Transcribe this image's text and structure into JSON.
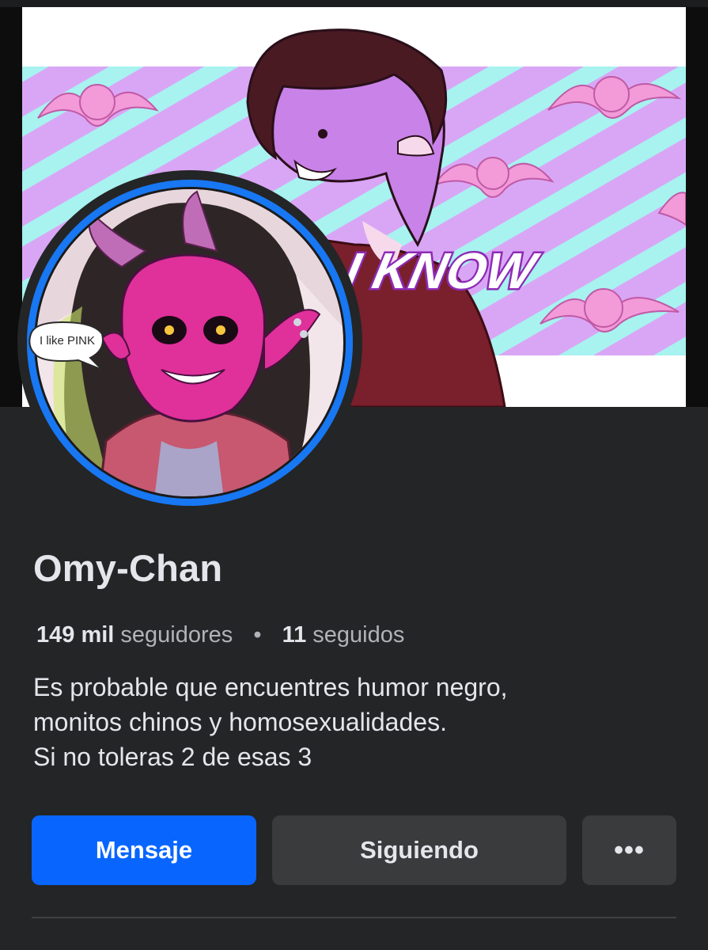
{
  "cover": {
    "image": "cover-photo",
    "caption_text": "I KNOW",
    "colors": {
      "stripe_lilac": "#d9a6f5",
      "stripe_cyan": "#a8f2f0",
      "bat_pink": "#f39ad8"
    }
  },
  "avatar": {
    "image": "profile-picture",
    "speech_bubble_text": "I like PINK",
    "ring_color": "#1877f2"
  },
  "profile": {
    "name": "Omy-Chan",
    "followers_count": "149 mil",
    "followers_label": "seguidores",
    "separator": "•",
    "following_count": "11",
    "following_label": "seguidos",
    "bio_lines": [
      "Es probable que encuentres humor negro,",
      "monitos chinos y homosexualidades.",
      "Si no toleras 2 de esas 3"
    ]
  },
  "actions": {
    "message_label": "Mensaje",
    "following_label": "Siguiendo",
    "more_label": "•••"
  },
  "colors": {
    "background": "#242526",
    "primary_button": "#0866ff",
    "secondary_button": "#3a3b3c",
    "text_primary": "#e4e6eb",
    "text_secondary": "#b0b3b8"
  }
}
